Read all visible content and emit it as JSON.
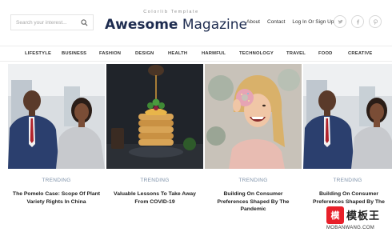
{
  "header": {
    "search_placeholder": "Search your interest...",
    "tagline": "Colorlib Template",
    "brand_bold": "Awesome",
    "brand_light": " Magazine",
    "links": [
      "About",
      "Contact",
      "Log In Or Sign Up"
    ],
    "social_icons": [
      "twitter-icon",
      "facebook-icon",
      "pinterest-icon"
    ]
  },
  "nav": {
    "items": [
      "LIFESTYLE",
      "BUSINESS",
      "FASHION",
      "DESIGN",
      "HEALTH",
      "HARMFUL",
      "TECHNOLOGY",
      "TRAVEL",
      "FOOD",
      "CREATIVE"
    ]
  },
  "cards": [
    {
      "category": "TRENDING",
      "title": "The Pomelo Case: Scope Of Plant Variety Rights In China"
    },
    {
      "category": "TRENDING",
      "title": "Valuable Lessons To Take Away From COVID-19"
    },
    {
      "category": "TRENDING",
      "title": "Building On Consumer Preferences Shaped By The Pandemic"
    },
    {
      "category": "TRENDING",
      "title": "Building On Consumer Preferences Shaped By The"
    }
  ],
  "watermark": {
    "logo_char": "模",
    "text": "模板王",
    "url": "MOBANWANG.COM"
  },
  "colors": {
    "brand": "#1d2b4f",
    "category": "#7c90a8",
    "watermark_red": "#e8202a"
  }
}
